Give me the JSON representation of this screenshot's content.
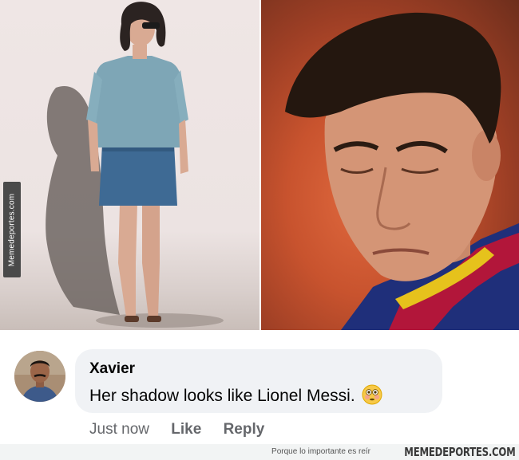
{
  "watermark": {
    "side_text": "Memedeportes.com"
  },
  "comment": {
    "author": "Xavier",
    "text": "Her shadow looks like Lionel Messi.",
    "emoji": "flushed-face-emoji"
  },
  "actions": {
    "time": "Just now",
    "like": "Like",
    "reply": "Reply"
  },
  "footer": {
    "tagline": "Porque lo importante es reír",
    "brand": "MEMEDEPORTES.COM"
  }
}
